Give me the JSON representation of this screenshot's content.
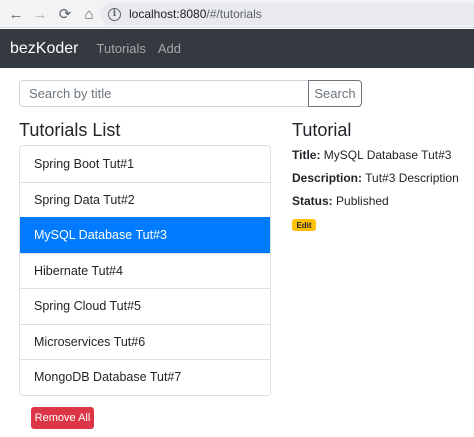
{
  "browser": {
    "url_host": "localhost:8080",
    "url_path": "/#/tutorials",
    "back_glyph": "←",
    "forward_glyph": "→",
    "reload_glyph": "⟳",
    "home_glyph": "⌂",
    "info_glyph": "i"
  },
  "navbar": {
    "brand": "bezKoder",
    "links": [
      "Tutorials",
      "Add"
    ]
  },
  "search": {
    "placeholder": "Search by title",
    "button_label": "Search"
  },
  "list": {
    "title": "Tutorials List",
    "items": [
      "Spring Boot Tut#1",
      "Spring Data Tut#2",
      "MySQL Database Tut#3",
      "Hibernate Tut#4",
      "Spring Cloud Tut#5",
      "Microservices Tut#6",
      "MongoDB Database Tut#7"
    ],
    "active_index": 2,
    "remove_all_label": "Remove All"
  },
  "detail": {
    "heading": "Tutorial",
    "title_label": "Title:",
    "title_value": "MySQL Database Tut#3",
    "description_label": "Description:",
    "description_value": "Tut#3 Description",
    "status_label": "Status:",
    "status_value": "Published",
    "edit_label": "Edit"
  },
  "colors": {
    "navbar_bg": "#343a40",
    "active_item": "#007bff",
    "danger": "#dc3545",
    "warning": "#ffc107"
  }
}
